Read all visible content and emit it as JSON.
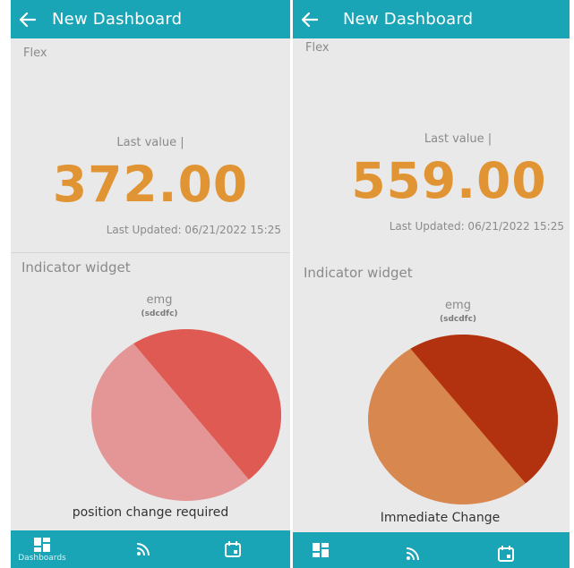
{
  "panels": [
    {
      "header_title": "New Dashboard",
      "section_label": "Flex",
      "last_value_label": "Last value |",
      "value": "372.00",
      "last_updated": "Last Updated: 06/21/2022 15:25",
      "indicator_title": "Indicator widget",
      "indicator_name": "emg",
      "indicator_source": "(sdcdfc)",
      "indicator_status": "position change required",
      "indicator_colors": {
        "upper": "#de5a52",
        "lower": "#e49595"
      },
      "nav": {
        "dashboards_label": "Dashboards"
      }
    },
    {
      "header_title": "New Dashboard",
      "section_label": "Flex",
      "last_value_label": "Last value |",
      "value": "559.00",
      "last_updated": "Last Updated: 06/21/2022 15:25",
      "indicator_title": "Indicator widget",
      "indicator_name": "emg",
      "indicator_source": "(sdcdfc)",
      "indicator_status": "Immediate Change",
      "indicator_colors": {
        "upper": "#b2320f",
        "lower": "#d8874f"
      },
      "nav": {
        "dashboards_label": ""
      }
    }
  ],
  "icons": {
    "back": "arrow-left-icon",
    "dashboards": "dashboards-grid-icon",
    "feed": "rss-feed-icon",
    "calendar": "calendar-icon"
  },
  "colors": {
    "header": "#1aa5b6",
    "value": "#e19433"
  }
}
